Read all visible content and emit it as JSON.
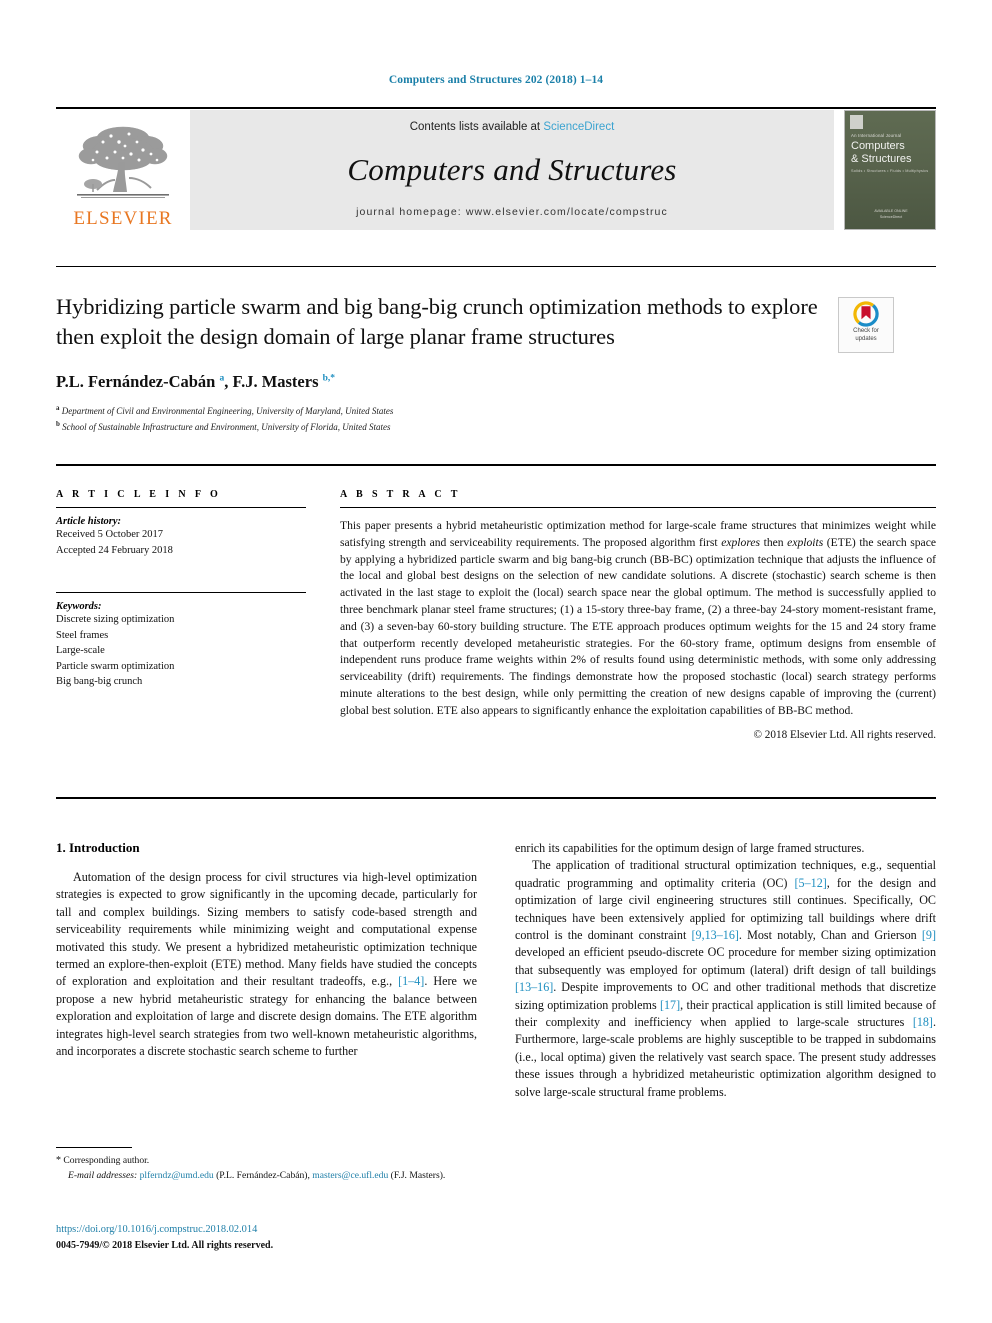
{
  "running_head": "Computers and Structures 202 (2018) 1–14",
  "masthead": {
    "publisher_name": "ELSEVIER",
    "contents_prefix": "Contents lists available at ",
    "contents_link": "ScienceDirect",
    "journal_title": "Computers and Structures",
    "homepage_label": "journal homepage: www.elsevier.com/locate/compstruc",
    "cover": {
      "kicker": "An International Journal",
      "name_line1": "Computers",
      "name_line2": "& Structures",
      "subtitle": "Solids • Structures • Fluids • Multiphysics",
      "footer": "AVAILABLE ONLINE\nScienceDirect"
    }
  },
  "article": {
    "title": "Hybridizing particle swarm and big bang-big crunch optimization methods to explore then exploit the design domain of large planar frame structures",
    "authors_html": "P.L. Fernández-Cabán <sup>a</sup>, F.J. Masters <sup>b,*</sup>",
    "affiliations": [
      {
        "marker": "a",
        "text": "Department of Civil and Environmental Engineering, University of Maryland, United States"
      },
      {
        "marker": "b",
        "text": "School of Sustainable Infrastructure and Environment, University of Florida, United States"
      }
    ],
    "crossmark_label": "Check for\nupdates"
  },
  "article_info": {
    "heading": "A R T I C L E   I N F O",
    "history_label": "Article history:",
    "history": [
      "Received 5 October 2017",
      "Accepted 24 February 2018"
    ],
    "keywords_label": "Keywords:",
    "keywords": [
      "Discrete sizing optimization",
      "Steel frames",
      "Large-scale",
      "Particle swarm optimization",
      "Big bang-big crunch"
    ]
  },
  "abstract": {
    "heading": "A B S T R A C T",
    "text_html": "This paper presents a hybrid metaheuristic optimization method for large-scale frame structures that minimizes weight while satisfying strength and serviceability requirements. The proposed algorithm first <i>explores</i> then <i>exploits</i> (ETE) the search space by applying a hybridized particle swarm and big bang-big crunch (BB-BC) optimization technique that adjusts the influence of the local and global best designs on the selection of new candidate solutions. A discrete (stochastic) search scheme is then activated in the last stage to exploit the (local) search space near the global optimum. The method is successfully applied to three benchmark planar steel frame structures; (1) a 15-story three-bay frame, (2) a three-bay 24-story moment-resistant frame, and (3) a seven-bay 60-story building structure. The ETE approach produces optimum weights for the 15 and 24 story frame that outperform recently developed metaheuristic strategies. For the 60-story frame, optimum designs from ensemble of independent runs produce frame weights within 2% of results found using deterministic methods, with some only addressing serviceability (drift) requirements. The findings demonstrate how the proposed stochastic (local) search strategy performs minute alterations to the best design, while only permitting the creation of new designs capable of improving the (current) global best solution. ETE also appears to significantly enhance the exploitation capabilities of BB-BC method.",
    "copyright": "© 2018 Elsevier Ltd. All rights reserved."
  },
  "introduction": {
    "heading": "1. Introduction",
    "left_para_html": "Automation of the design process for civil structures via high-level optimization strategies is expected to grow significantly in the upcoming decade, particularly for tall and complex buildings. Sizing members to satisfy code-based strength and serviceability requirements while minimizing weight and computational expense motivated this study. We present a hybridized metaheuristic optimization technique termed an explore-then-exploit (ETE) method. Many fields have studied the concepts of exploration and exploitation and their resultant tradeoffs, e.g., <span class=\"ref\">[1–4]</span>. Here we propose a new hybrid metaheuristic strategy for enhancing the balance between exploration and exploitation of large and discrete design domains. The ETE algorithm integrates high-level search strategies from two well-known metaheuristic algorithms, and incorporates a discrete stochastic search scheme to further",
    "right_para1_html": "enrich its capabilities for the optimum design of large framed structures.",
    "right_para2_html": "The application of traditional structural optimization techniques, e.g., sequential quadratic programming and optimality criteria (OC) <span class=\"ref\">[5–12]</span>, for the design and optimization of large civil engineering structures still continues. Specifically, OC techniques have been extensively applied for optimizing tall buildings where drift control is the dominant constraint <span class=\"ref\">[9,13–16]</span>. Most notably, Chan and Grierson <span class=\"ref\">[9]</span> developed an efficient pseudo-discrete OC procedure for member sizing optimization that subsequently was employed for optimum (lateral) drift design of tall buildings <span class=\"ref\">[13–16]</span>. Despite improvements to OC and other traditional methods that discretize sizing optimization problems <span class=\"ref\">[17]</span>, their practical application is still limited because of their complexity and inefficiency when applied to large-scale structures <span class=\"ref\">[18]</span>. Furthermore, large-scale problems are highly susceptible to be trapped in subdomains (i.e., local optima) given the relatively vast search space. The present study addresses these issues through a hybridized metaheuristic optimization algorithm designed to solve large-scale structural frame problems."
  },
  "footnotes": {
    "corresponding_html": "<span class=\"star\">*</span> Corresponding author.",
    "emails_html": "<span class=\"em-label\">E-mail addresses:</span> <span class=\"link\">plferndz@umd.edu</span> (P.L. Fernández-Cabán), <span class=\"link\">masters@ce.ufl.edu</span> (F.J. Masters).",
    "doi": "https://doi.org/10.1016/j.compstruc.2018.02.014",
    "issn": "0045-7949/© 2018 Elsevier Ltd. All rights reserved."
  },
  "colors": {
    "link_blue": "#1f8fc0",
    "head_blue": "#1a7fa8",
    "elsevier_orange": "#e87722",
    "masthead_gray": "#e8e8e8"
  }
}
